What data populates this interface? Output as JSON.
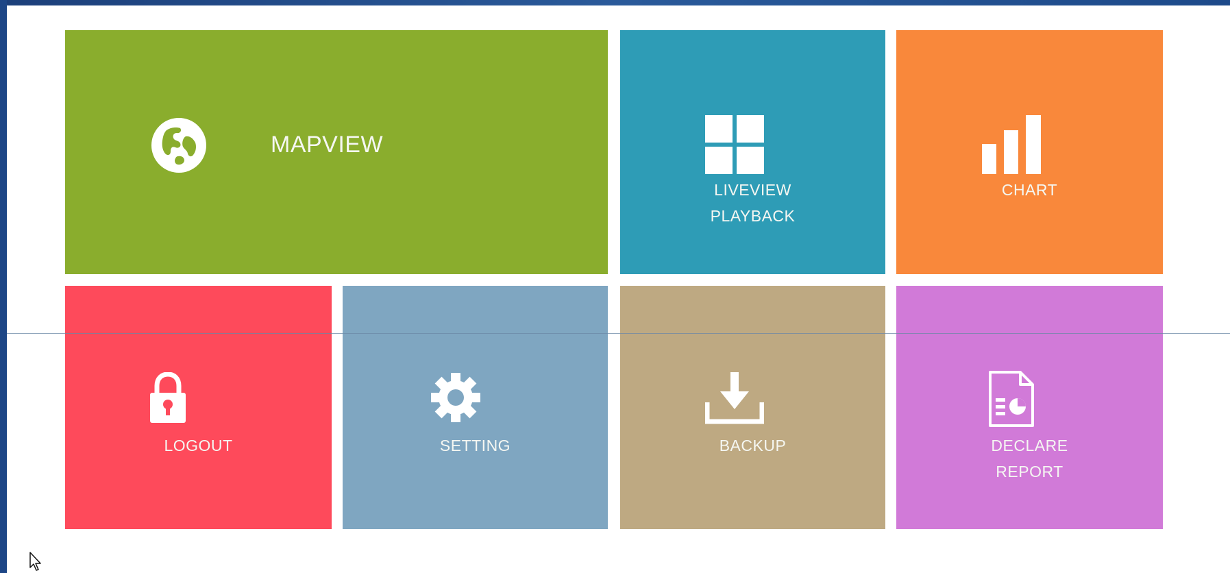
{
  "tiles": {
    "mapview": {
      "label": "MAPVIEW",
      "color": "#8aad2d",
      "icon": "globe-icon"
    },
    "liveview": {
      "line1": "LIVEVIEW",
      "line2": "PLAYBACK",
      "color": "#2e9cb6",
      "icon": "grid-icon"
    },
    "chart": {
      "label": "CHART",
      "color": "#f9883b",
      "icon": "bar-chart-icon"
    },
    "logout": {
      "label": "LOGOUT",
      "color": "#fe4a5b",
      "icon": "lock-icon"
    },
    "setting": {
      "label": "SETTING",
      "color": "#7fa6c1",
      "icon": "gear-icon"
    },
    "backup": {
      "label": "BACKUP",
      "color": "#bea982",
      "icon": "download-icon"
    },
    "declare": {
      "line1": "DECLARE",
      "line2": "REPORT",
      "color": "#d17ad8",
      "icon": "report-document-icon"
    }
  },
  "frame": {
    "color": "#1d4686"
  },
  "cursor": {
    "icon": "mouse-pointer-icon"
  }
}
